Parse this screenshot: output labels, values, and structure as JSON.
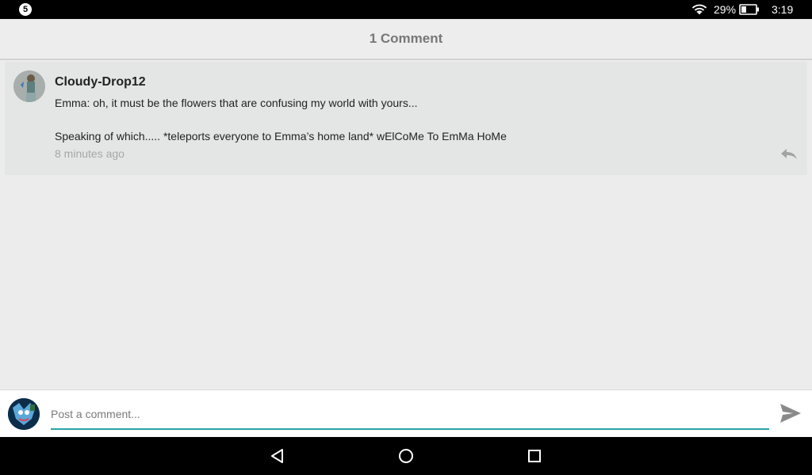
{
  "status_bar": {
    "notification_count": "5",
    "battery_percent": "29%",
    "time": "3:19",
    "icons": [
      "wifi-icon",
      "battery-icon"
    ]
  },
  "header": {
    "title": "1 Comment"
  },
  "comments": [
    {
      "author": "Cloudy-Drop12",
      "text": "Emma: oh, it must be the flowers that are confusing my world with yours...\n\nSpeaking of which..... *teleports everyone to Emma’s home land* wElCoMe To EmMa HoMe",
      "time": "8 minutes ago",
      "icons": [
        "avatar",
        "reply-icon"
      ]
    }
  ],
  "composer": {
    "placeholder": "Post a comment...",
    "value": "",
    "icons": [
      "user-avatar",
      "send-icon"
    ]
  },
  "nav_bar": {
    "icons": [
      "back-icon",
      "home-icon",
      "recents-icon"
    ]
  },
  "colors": {
    "accent": "#29a3a3",
    "background": "#ececec",
    "comment_bg": "#e4e6e6"
  }
}
